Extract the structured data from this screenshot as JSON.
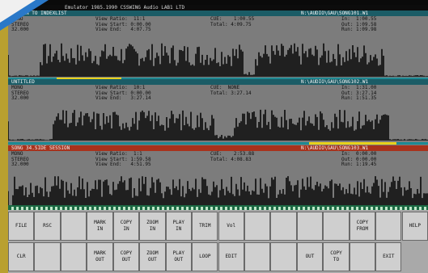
{
  "window": {
    "title": "Emulator 1985.1990 CSSWING Audio LAB1 LTD"
  },
  "panels": [
    {
      "label": "RETURN TO INDEXLIST",
      "path": "N:\\AUDIO\\GAU\\SONG101.W1",
      "format": "MONO\nSTEREO\n32.000",
      "view": "View Ratio:  11:1\nView Start: 0:00.00\nView End:   4:07.75",
      "totals": "CUE:    1:00.55\nTotal: 4:09.75",
      "markers": "In:  1:00.55\nOut: 1:09.58\nRun: 1:09.98"
    },
    {
      "label": "UNTITLED",
      "path": "N:\\AUDIO\\GAU\\SONG102.W1",
      "format": "MONO\nSTEREO\n32.000",
      "view": "View Ratio:  10:1\nView Start: 0:00.00\nView End:   3:27.14",
      "totals": "CUE:  NONE\nTotal: 3:27.14",
      "markers": "In:  1:31.00\nOut: 3:27.14\nRun: 1:51.35"
    },
    {
      "label": "SONG 34.SIDE SESSION",
      "path": "N:\\AUDIO\\GAU\\SONG103.W1",
      "format": "MONO\nSTEREO\n32.000",
      "view": "View Ratio:  1:1\nView Start: 1:59.58\nView End:   4:51.95",
      "totals": "CUE:    2:53.88\nTotal: 4:08.83",
      "markers": "In:  0:00.00\nOut: 0:00.00\nRun: 1:19.45"
    }
  ],
  "buttons": [
    {
      "name": "file-button",
      "label": "FILE"
    },
    {
      "name": "rsc-button",
      "label": "RSC"
    },
    {
      "name": "empty-button-1",
      "label": ""
    },
    {
      "name": "mark-in-button",
      "label": "MARK\nIN"
    },
    {
      "name": "copy-in-button",
      "label": "COPY\nIN"
    },
    {
      "name": "zoom-in-button",
      "label": "ZOOM\nIN"
    },
    {
      "name": "play-in-button",
      "label": "PLAY\nIN"
    },
    {
      "name": "trim-button",
      "label": "TRIM"
    },
    {
      "name": "vol-button",
      "label": "Vol"
    },
    {
      "name": "empty-button-2",
      "label": ""
    },
    {
      "name": "empty-button-3",
      "label": ""
    },
    {
      "name": "empty-button-4",
      "label": ""
    },
    {
      "name": "empty-button-5",
      "label": ""
    },
    {
      "name": "copy-from-button",
      "label": "COPY\nFROM"
    },
    {
      "name": "empty-button-6",
      "label": ""
    },
    {
      "name": "help-button",
      "label": "HELP"
    },
    {
      "name": "clr-button",
      "label": "CLR"
    },
    {
      "name": "empty-button-7",
      "label": ""
    },
    {
      "name": "empty-button-8",
      "label": ""
    },
    {
      "name": "mark-out-button",
      "label": "MARK\nOUT"
    },
    {
      "name": "copy-out-button",
      "label": "COPY\nOUT"
    },
    {
      "name": "zoom-out-button",
      "label": "ZOOM\nOUT"
    },
    {
      "name": "play-out-button",
      "label": "PLAY\nOUT"
    },
    {
      "name": "loop-button",
      "label": "LOOP"
    },
    {
      "name": "edit-button",
      "label": "EDIT"
    },
    {
      "name": "empty-button-9",
      "label": ""
    },
    {
      "name": "empty-button-10",
      "label": ""
    },
    {
      "name": "out-button",
      "label": "OUT"
    },
    {
      "name": "copy-to-button",
      "label": "COPY\nTO"
    },
    {
      "name": "empty-button-11",
      "label": ""
    },
    {
      "name": "exit-button",
      "label": "EXIT"
    }
  ],
  "colors": {
    "header_teal": "#1b5c66",
    "header_red": "#a8321c",
    "playbar": "#1e8a94",
    "selection": "#e8d21c"
  }
}
